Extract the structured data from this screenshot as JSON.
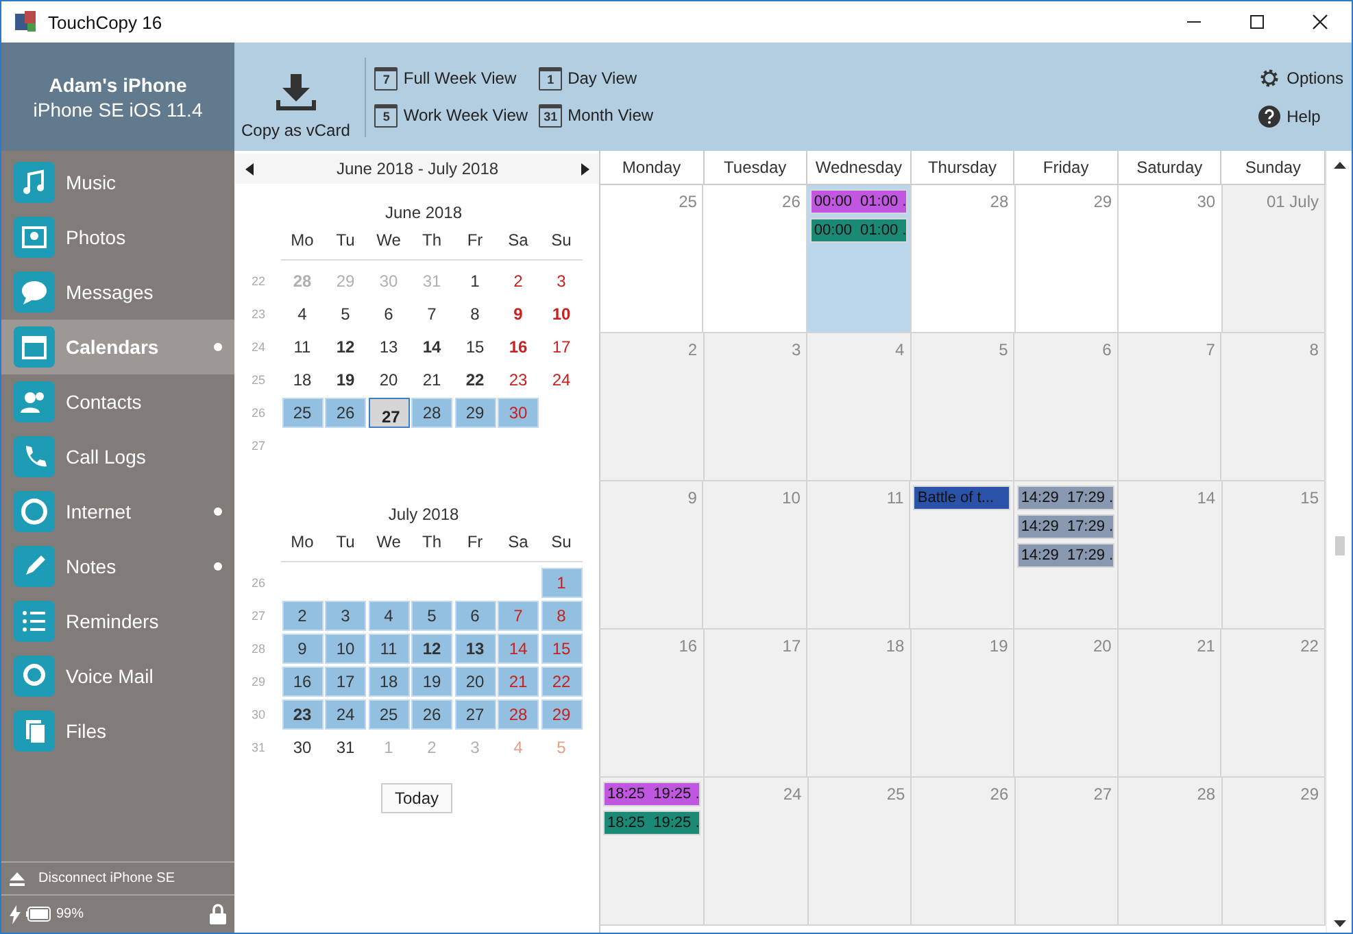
{
  "window": {
    "title": "TouchCopy 16"
  },
  "device": {
    "name": "Adam's iPhone",
    "model": "iPhone SE iOS 11.4"
  },
  "toolbar": {
    "copy_button": "Copy as vCard",
    "views": [
      {
        "label": "Full Week View",
        "icon_text": "7"
      },
      {
        "label": "Day View",
        "icon_text": "1"
      },
      {
        "label": "Work Week View",
        "icon_text": "5"
      },
      {
        "label": "Month View",
        "icon_text": "31"
      }
    ],
    "options": "Options",
    "help": "Help"
  },
  "sidebar": {
    "items": [
      {
        "label": "Music",
        "selected": false,
        "dot": false
      },
      {
        "label": "Photos",
        "selected": false,
        "dot": false
      },
      {
        "label": "Messages",
        "selected": false,
        "dot": false
      },
      {
        "label": "Calendars",
        "selected": true,
        "dot": true
      },
      {
        "label": "Contacts",
        "selected": false,
        "dot": false
      },
      {
        "label": "Call Logs",
        "selected": false,
        "dot": false
      },
      {
        "label": "Internet",
        "selected": false,
        "dot": true
      },
      {
        "label": "Notes",
        "selected": false,
        "dot": true
      },
      {
        "label": "Reminders",
        "selected": false,
        "dot": false
      },
      {
        "label": "Voice Mail",
        "selected": false,
        "dot": false
      },
      {
        "label": "Files",
        "selected": false,
        "dot": false
      }
    ],
    "disconnect": "Disconnect iPhone SE",
    "battery": "99%"
  },
  "mini_calendar": {
    "range": "June 2018 - July 2018",
    "today_button": "Today",
    "months": [
      {
        "title": "June 2018",
        "weekdays": [
          "Mo",
          "Tu",
          "We",
          "Th",
          "Fr",
          "Sa",
          "Su"
        ],
        "weeks": [
          {
            "week": "22",
            "days": [
              {
                "d": "28",
                "muted": true,
                "busy": true,
                "selected": false,
                "today": false
              },
              {
                "d": "29",
                "muted": true,
                "busy": false,
                "selected": false,
                "today": false
              },
              {
                "d": "30",
                "muted": true,
                "busy": false,
                "selected": false,
                "today": false
              },
              {
                "d": "31",
                "muted": true,
                "busy": false,
                "selected": false,
                "today": false
              },
              {
                "d": "1",
                "muted": false,
                "busy": false,
                "selected": false,
                "today": false
              },
              {
                "d": "2",
                "muted": false,
                "busy": false,
                "selected": false,
                "today": false
              },
              {
                "d": "3",
                "muted": false,
                "busy": false,
                "selected": false,
                "today": false
              }
            ]
          },
          {
            "week": "23",
            "days": [
              {
                "d": "4",
                "muted": false,
                "busy": false,
                "selected": false,
                "today": false
              },
              {
                "d": "5",
                "muted": false,
                "busy": false,
                "selected": false,
                "today": false
              },
              {
                "d": "6",
                "muted": false,
                "busy": false,
                "selected": false,
                "today": false
              },
              {
                "d": "7",
                "muted": false,
                "busy": false,
                "selected": false,
                "today": false
              },
              {
                "d": "8",
                "muted": false,
                "busy": false,
                "selected": false,
                "today": false
              },
              {
                "d": "9",
                "muted": false,
                "busy": true,
                "selected": false,
                "today": false
              },
              {
                "d": "10",
                "muted": false,
                "busy": true,
                "selected": false,
                "today": false
              }
            ]
          },
          {
            "week": "24",
            "days": [
              {
                "d": "11",
                "muted": false,
                "busy": false,
                "selected": false,
                "today": false
              },
              {
                "d": "12",
                "muted": false,
                "busy": true,
                "selected": false,
                "today": false
              },
              {
                "d": "13",
                "muted": false,
                "busy": false,
                "selected": false,
                "today": false
              },
              {
                "d": "14",
                "muted": false,
                "busy": true,
                "selected": false,
                "today": false
              },
              {
                "d": "15",
                "muted": false,
                "busy": false,
                "selected": false,
                "today": false
              },
              {
                "d": "16",
                "muted": false,
                "busy": true,
                "selected": false,
                "today": false
              },
              {
                "d": "17",
                "muted": false,
                "busy": false,
                "selected": false,
                "today": false
              }
            ]
          },
          {
            "week": "25",
            "days": [
              {
                "d": "18",
                "muted": false,
                "busy": false,
                "selected": false,
                "today": false
              },
              {
                "d": "19",
                "muted": false,
                "busy": true,
                "selected": false,
                "today": false
              },
              {
                "d": "20",
                "muted": false,
                "busy": false,
                "selected": false,
                "today": false
              },
              {
                "d": "21",
                "muted": false,
                "busy": false,
                "selected": false,
                "today": false
              },
              {
                "d": "22",
                "muted": false,
                "busy": true,
                "selected": false,
                "today": false
              },
              {
                "d": "23",
                "muted": false,
                "busy": false,
                "selected": false,
                "today": false
              },
              {
                "d": "24",
                "muted": false,
                "busy": false,
                "selected": false,
                "today": false
              }
            ]
          },
          {
            "week": "26",
            "days": [
              {
                "d": "25",
                "muted": false,
                "busy": false,
                "selected": true,
                "today": false
              },
              {
                "d": "26",
                "muted": false,
                "busy": false,
                "selected": true,
                "today": false
              },
              {
                "d": "27",
                "muted": false,
                "busy": true,
                "selected": true,
                "today": true
              },
              {
                "d": "28",
                "muted": false,
                "busy": false,
                "selected": true,
                "today": false
              },
              {
                "d": "29",
                "muted": false,
                "busy": false,
                "selected": true,
                "today": false
              },
              {
                "d": "30",
                "muted": false,
                "busy": false,
                "selected": true,
                "today": false
              }
            ]
          },
          {
            "week": "27"
          }
        ]
      },
      {
        "title": "July 2018",
        "weekdays": [
          "Mo",
          "Tu",
          "We",
          "Th",
          "Fr",
          "Sa",
          "Su"
        ],
        "weeks": [
          {
            "week": "26",
            "kind": "tail",
            "days": [
              {
                "d": "1",
                "muted": false,
                "busy": false,
                "selected": true,
                "today": false
              }
            ]
          },
          {
            "week": "27",
            "days": [
              {
                "d": "2",
                "muted": false,
                "busy": false,
                "selected": true,
                "today": false
              },
              {
                "d": "3",
                "muted": false,
                "busy": false,
                "selected": true,
                "today": false
              },
              {
                "d": "4",
                "muted": false,
                "busy": false,
                "selected": true,
                "today": false
              },
              {
                "d": "5",
                "muted": false,
                "busy": false,
                "selected": true,
                "today": false
              },
              {
                "d": "6",
                "muted": false,
                "busy": false,
                "selected": true,
                "today": false
              },
              {
                "d": "7",
                "muted": false,
                "busy": false,
                "selected": true,
                "today": false
              },
              {
                "d": "8",
                "muted": false,
                "busy": false,
                "selected": true,
                "today": false
              }
            ]
          },
          {
            "week": "28",
            "days": [
              {
                "d": "9",
                "muted": false,
                "busy": false,
                "selected": true,
                "today": false
              },
              {
                "d": "10",
                "muted": false,
                "busy": false,
                "selected": true,
                "today": false
              },
              {
                "d": "11",
                "muted": false,
                "busy": false,
                "selected": true,
                "today": false
              },
              {
                "d": "12",
                "muted": false,
                "busy": true,
                "selected": true,
                "today": false
              },
              {
                "d": "13",
                "muted": false,
                "busy": true,
                "selected": true,
                "today": false
              },
              {
                "d": "14",
                "muted": false,
                "busy": false,
                "selected": true,
                "today": false
              },
              {
                "d": "15",
                "muted": false,
                "busy": false,
                "selected": true,
                "today": false
              }
            ]
          },
          {
            "week": "29",
            "days": [
              {
                "d": "16",
                "muted": false,
                "busy": false,
                "selected": true,
                "today": false
              },
              {
                "d": "17",
                "muted": false,
                "busy": false,
                "selected": true,
                "today": false
              },
              {
                "d": "18",
                "muted": false,
                "busy": false,
                "selected": true,
                "today": false
              },
              {
                "d": "19",
                "muted": false,
                "busy": false,
                "selected": true,
                "today": false
              },
              {
                "d": "20",
                "muted": false,
                "busy": false,
                "selected": true,
                "today": false
              },
              {
                "d": "21",
                "muted": false,
                "busy": false,
                "selected": true,
                "today": false
              },
              {
                "d": "22",
                "muted": false,
                "busy": false,
                "selected": true,
                "today": false
              }
            ]
          },
          {
            "week": "30",
            "days": [
              {
                "d": "23",
                "muted": false,
                "busy": true,
                "selected": true,
                "today": false
              },
              {
                "d": "24",
                "muted": false,
                "busy": false,
                "selected": true,
                "today": false
              },
              {
                "d": "25",
                "muted": false,
                "busy": false,
                "selected": true,
                "today": false
              },
              {
                "d": "26",
                "muted": false,
                "busy": false,
                "selected": true,
                "today": false
              },
              {
                "d": "27",
                "muted": false,
                "busy": false,
                "selected": true,
                "today": false
              },
              {
                "d": "28",
                "muted": false,
                "busy": false,
                "selected": true,
                "today": false
              },
              {
                "d": "29",
                "muted": false,
                "busy": false,
                "selected": true,
                "today": false
              }
            ]
          },
          {
            "week": "31",
            "days": [
              {
                "d": "30",
                "muted": false,
                "busy": false,
                "selected": false,
                "today": false
              },
              {
                "d": "31",
                "muted": false,
                "busy": false,
                "selected": false,
                "today": false
              },
              {
                "d": "1",
                "muted": true,
                "busy": false,
                "selected": false,
                "today": false
              },
              {
                "d": "2",
                "muted": true,
                "busy": false,
                "selected": false,
                "today": false
              },
              {
                "d": "3",
                "muted": true,
                "busy": false,
                "selected": false,
                "today": false
              },
              {
                "d": "4",
                "muted": true,
                "busy": false,
                "selected": false,
                "today": false
              },
              {
                "d": "5",
                "muted": true,
                "busy": false,
                "selected": false,
                "today": false
              }
            ]
          }
        ]
      }
    ]
  },
  "month_view": {
    "columns": [
      "Monday",
      "Tuesday",
      "Wednesday",
      "Thursday",
      "Friday",
      "Saturday",
      "Sunday"
    ],
    "weeks": [
      [
        {
          "day": "25",
          "shaded": false,
          "selected": false
        },
        {
          "day": "26",
          "shaded": false,
          "selected": false
        },
        {
          "selected": true,
          "events": [
            {
              "text": "00:00  01:00 .",
              "color": "#c157e0"
            },
            {
              "text": "00:00  01:00 .",
              "color": "#1a8a76"
            }
          ]
        },
        {
          "day": "28",
          "shaded": false,
          "selected": false
        },
        {
          "day": "29",
          "shaded": false,
          "selected": false
        },
        {
          "day": "30",
          "shaded": false,
          "selected": false
        },
        {
          "day": "01 July",
          "shaded": true,
          "selected": false
        }
      ],
      [
        {
          "day": "2",
          "shaded": true,
          "selected": false
        },
        {
          "day": "3",
          "shaded": true,
          "selected": false
        },
        {
          "day": "4",
          "shaded": true,
          "selected": false
        },
        {
          "day": "5",
          "shaded": true,
          "selected": false
        },
        {
          "day": "6",
          "shaded": true,
          "selected": false
        },
        {
          "day": "7",
          "shaded": true,
          "selected": false
        },
        {
          "day": "8",
          "shaded": true,
          "selected": false
        }
      ],
      [
        {
          "day": "9",
          "shaded": true,
          "selected": false
        },
        {
          "day": "10",
          "shaded": true,
          "selected": false
        },
        {
          "day": "11",
          "shaded": true,
          "selected": false
        },
        {
          "shaded": true,
          "selected": false,
          "events": [
            {
              "text": "Battle of t...",
              "color": "#2a52a8"
            }
          ]
        },
        {
          "shaded": true,
          "selected": false,
          "events": [
            {
              "text": "14:29  17:29 .",
              "color": "#8898b0"
            },
            {
              "text": "14:29  17:29 .",
              "color": "#8898b0"
            },
            {
              "text": "14:29  17:29 .",
              "color": "#8898b0"
            }
          ]
        },
        {
          "day": "14",
          "shaded": true,
          "selected": false
        },
        {
          "day": "15",
          "shaded": true,
          "selected": false
        }
      ],
      [
        {
          "day": "16",
          "shaded": true,
          "selected": false
        },
        {
          "day": "17",
          "shaded": true,
          "selected": false
        },
        {
          "day": "18",
          "shaded": true,
          "selected": false
        },
        {
          "day": "19",
          "shaded": true,
          "selected": false
        },
        {
          "day": "20",
          "shaded": true,
          "selected": false
        },
        {
          "day": "21",
          "shaded": true,
          "selected": false
        },
        {
          "day": "22",
          "shaded": true,
          "selected": false
        }
      ],
      [
        {
          "shaded": true,
          "selected": false,
          "events": [
            {
              "text": "18:25  19:25 .",
              "color": "#c157e0"
            },
            {
              "text": "18:25  19:25 .",
              "color": "#1a8a76"
            }
          ]
        },
        {
          "day": "24",
          "shaded": true,
          "selected": false
        },
        {
          "day": "25",
          "shaded": true,
          "selected": false
        },
        {
          "day": "26",
          "shaded": true,
          "selected": false
        },
        {
          "day": "27",
          "shaded": true,
          "selected": false
        },
        {
          "day": "28",
          "shaded": true,
          "selected": false
        },
        {
          "day": "29",
          "shaded": true,
          "selected": false
        }
      ]
    ]
  }
}
